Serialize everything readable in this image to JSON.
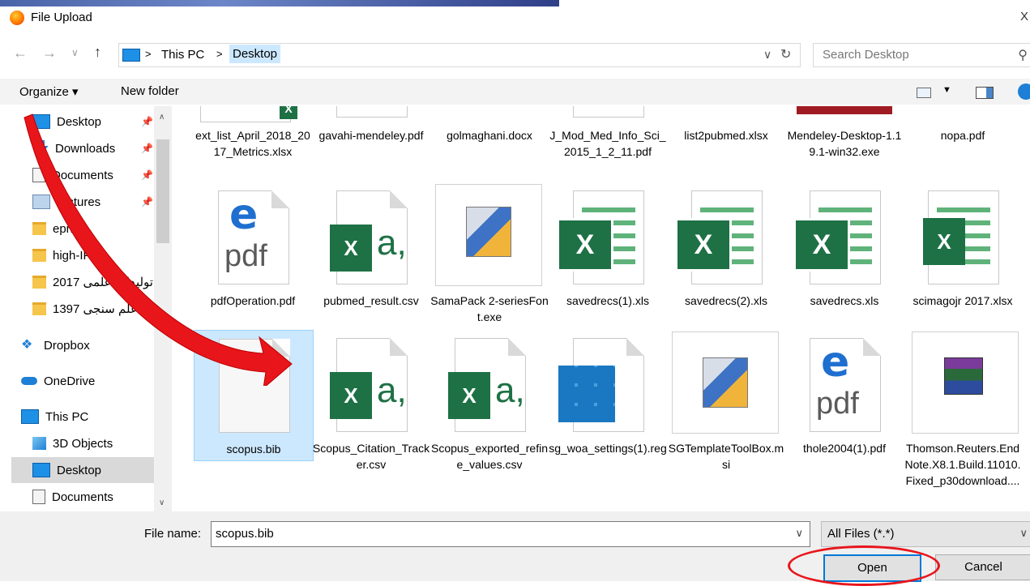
{
  "window": {
    "title": "File Upload",
    "close": "X"
  },
  "address": {
    "this_pc": "This PC",
    "folder": "Desktop",
    "sep": ">",
    "dropdown": "∨",
    "refresh": "↻"
  },
  "search": {
    "placeholder": "Search Desktop"
  },
  "toolbar": {
    "organize": "Organize ▾",
    "new_folder": "New folder"
  },
  "nav": {
    "desktop": "Desktop",
    "downloads": "Downloads",
    "documents": "Documents",
    "pictures": "Pictures",
    "eprints": "eprints",
    "highif": "high-IF",
    "f2017": "تولیدات علمی 2017",
    "f1397": "علم سنجی 1397",
    "dropbox": "Dropbox",
    "onedrive": "OneDrive",
    "thispc": "This PC",
    "objects3d": "3D Objects",
    "desktop2": "Desktop",
    "documents2": "Documents"
  },
  "files": {
    "row0": [
      "ext_list_April_2018_2017_Metrics.xlsx",
      "gavahi-mendeley.pdf",
      "golmaghani.docx",
      "J_Mod_Med_Info_Sci_2015_1_2_11.pdf",
      "list2pubmed.xlsx",
      "Mendeley-Desktop-1.19.1-win32.exe",
      "nopa.pdf"
    ],
    "row1": [
      "pdfOperation.pdf",
      "pubmed_result.csv",
      "SamaPack 2-seriesFont.exe",
      "savedrecs(1).xls",
      "savedrecs(2).xls",
      "savedrecs.xls",
      "scimagojr 2017.xlsx"
    ],
    "row2": [
      "scopus.bib",
      "Scopus_Citation_Tracker.csv",
      "Scopus_exported_refine_values.csv",
      "sg_woa_settings(1).reg",
      "SGTemplateToolBox.msi",
      "thole2004(1).pdf",
      "Thomson.Reuters.EndNote.X8.1.Build.11010.Fixed_p30download...."
    ]
  },
  "icons": {
    "x": "X",
    "a": "a,",
    "e": "e",
    "pdf": "pdf"
  },
  "bottom": {
    "file_name_label": "File name:",
    "file_name_value": "scopus.bib",
    "filter": "All Files (*.*)",
    "open": "Open",
    "cancel": "Cancel"
  },
  "colors": {
    "accent": "#0078d7",
    "selection": "#cce8ff",
    "arrow": "#e8151b",
    "excel": "#1e7145"
  }
}
